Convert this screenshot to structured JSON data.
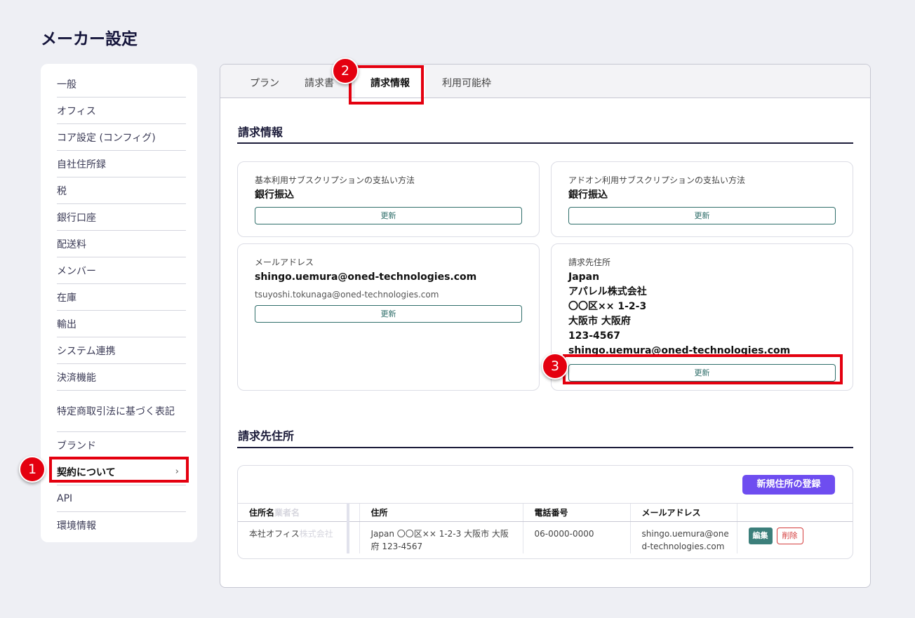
{
  "page_title": "メーカー設定",
  "sidebar": {
    "items": [
      {
        "label": "一般"
      },
      {
        "label": "オフィス"
      },
      {
        "label": "コア設定 (コンフィグ)"
      },
      {
        "label": "自社住所録"
      },
      {
        "label": "税"
      },
      {
        "label": "銀行口座"
      },
      {
        "label": "配送料"
      },
      {
        "label": "メンバー"
      },
      {
        "label": "在庫"
      },
      {
        "label": "輸出"
      },
      {
        "label": "システム連携"
      },
      {
        "label": "決済機能"
      },
      {
        "label": "特定商取引法に基づく表記"
      },
      {
        "label": "ブランド"
      },
      {
        "label": "契約について",
        "chevron": "›"
      },
      {
        "label": "API"
      },
      {
        "label": "環境情報"
      }
    ]
  },
  "tabs": [
    {
      "label": "プラン"
    },
    {
      "label": "請求書"
    },
    {
      "label": "請求情報"
    },
    {
      "label": "利用可能枠"
    }
  ],
  "billing": {
    "section_title": "請求情報",
    "base_payment": {
      "label": "基本利用サブスクリプションの支払い方法",
      "value": "銀行振込",
      "button": "更新"
    },
    "addon_payment": {
      "label": "アドオン利用サブスクリプションの支払い方法",
      "value": "銀行振込",
      "button": "更新"
    },
    "email": {
      "label": "メールアドレス",
      "value": "shingo.uemura@oned-technologies.com",
      "sub": "tsuyoshi.tokunaga@oned-technologies.com",
      "button": "更新"
    },
    "address": {
      "label": "請求先住所",
      "lines": [
        "Japan",
        "アパレル株式会社",
        "〇〇区×× 1-2-3",
        "大阪市 大阪府",
        "123-4567",
        "shingo.uemura@oned-technologies.com"
      ],
      "button": "更新"
    }
  },
  "addresses": {
    "section_title": "請求先住所",
    "new_button": "新規住所の登録",
    "columns": {
      "name": "住所名",
      "name_faded": "業者名",
      "address": "住所",
      "phone": "電話番号",
      "email": "メールアドレス"
    },
    "rows": [
      {
        "name": "本社オフィス",
        "name_faded": "株式会社",
        "address": "Japan 〇〇区×× 1-2-3 大阪市 大阪府 123-4567",
        "phone": "06-0000-0000",
        "email": "shingo.uemura@oned-technologies.com",
        "edit": "編集",
        "delete": "削除"
      }
    ]
  },
  "annotations": {
    "badge1": "1",
    "badge2": "2",
    "badge3": "3"
  }
}
